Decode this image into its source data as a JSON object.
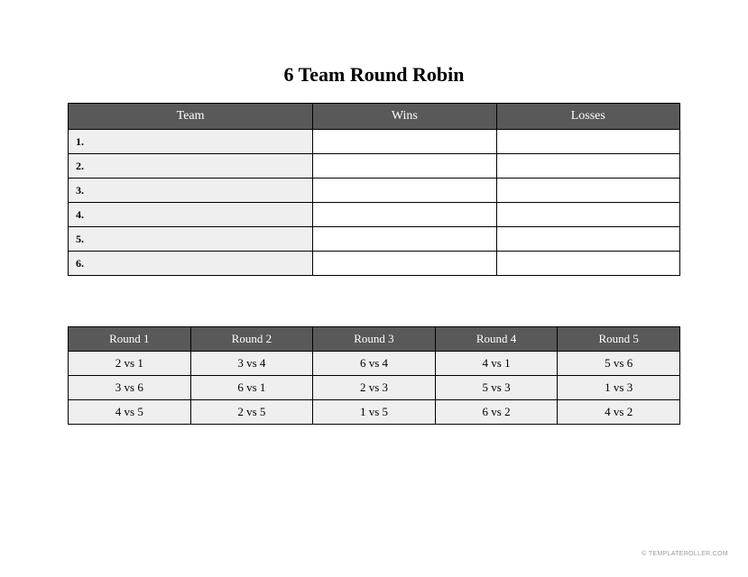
{
  "title": "6 Team Round Robin",
  "standings": {
    "headers": {
      "team": "Team",
      "wins": "Wins",
      "losses": "Losses"
    },
    "rows": [
      {
        "label": "1.",
        "wins": "",
        "losses": ""
      },
      {
        "label": "2.",
        "wins": "",
        "losses": ""
      },
      {
        "label": "3.",
        "wins": "",
        "losses": ""
      },
      {
        "label": "4.",
        "wins": "",
        "losses": ""
      },
      {
        "label": "5.",
        "wins": "",
        "losses": ""
      },
      {
        "label": "6.",
        "wins": "",
        "losses": ""
      }
    ]
  },
  "schedule": {
    "headers": [
      "Round 1",
      "Round 2",
      "Round 3",
      "Round 4",
      "Round 5"
    ],
    "rows": [
      [
        "2 vs 1",
        "3 vs 4",
        "6 vs 4",
        "4 vs 1",
        "5 vs 6"
      ],
      [
        "3 vs 6",
        "6 vs 1",
        "2 vs 3",
        "5 vs 3",
        "1 vs 3"
      ],
      [
        "4 vs 5",
        "2 vs 5",
        "1 vs 5",
        "6 vs 2",
        "4 vs 2"
      ]
    ]
  },
  "footer": "© TEMPLATEROLLER.COM"
}
